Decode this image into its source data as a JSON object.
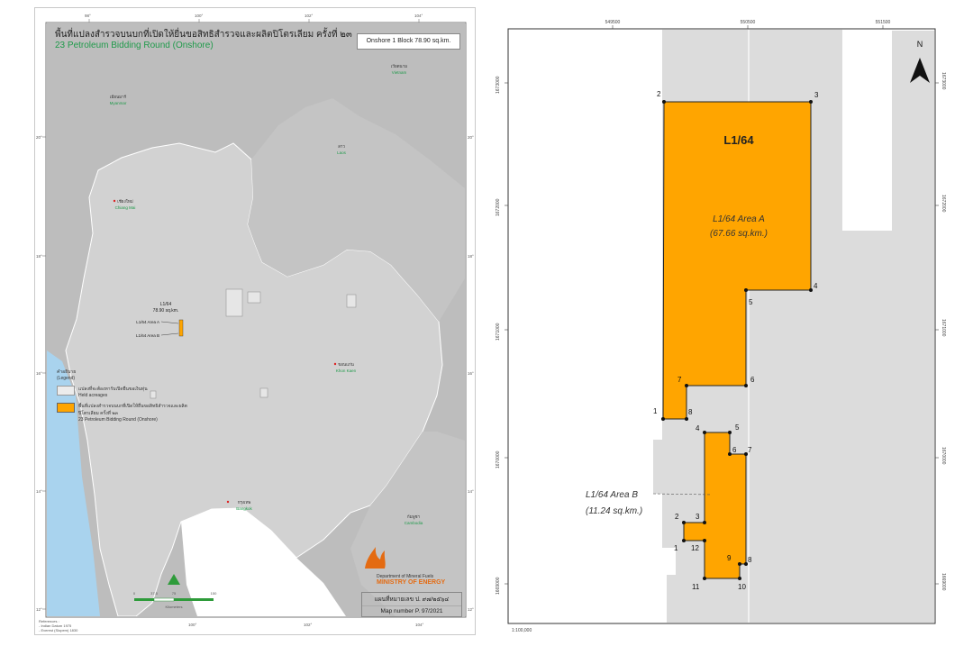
{
  "left_map": {
    "title_th": "พื้นที่แปลงสำรวจบนบกที่เปิดให้ยื่นขอสิทธิสำรวจและผลิตปิโตรเลียม ครั้งที่ ๒๓",
    "title_en": "23  Petroleum Bidding Round (Onshore)",
    "area_box": "Onshore 1 Block 78.90 sq.km.",
    "top_ticks": [
      "98°",
      "100°",
      "102°",
      "104°"
    ],
    "bottom_ticks": [
      "100°",
      "102°",
      "104°"
    ],
    "left_ticks": [
      "20°",
      "18°",
      "16°",
      "14°",
      "12°"
    ],
    "right_ticks": [
      "20°",
      "18°",
      "16°",
      "14°",
      "12°"
    ],
    "places": [
      {
        "th": "เมียนมาร์",
        "en": "Myanmar",
        "color": "#1f9a4a"
      },
      {
        "th": "เวียดนาม",
        "en": "Vietnam",
        "color": "#1f9a4a"
      },
      {
        "th": "ลาว",
        "en": "Laos",
        "color": "#1f9a4a"
      },
      {
        "th": "เชียงใหม่",
        "en": "Chiang Mai",
        "color": "#1f9a4a"
      },
      {
        "th": "ขอนแก่น",
        "en": "Khon Kaen",
        "color": "#1f9a4a"
      },
      {
        "th": "กรุงเทพ",
        "en": "Bangkok",
        "color": "#1f9a4a"
      },
      {
        "th": "กัมพูชา",
        "en": "Cambodia",
        "color": "#1f9a4a"
      }
    ],
    "block_callout": {
      "name": "L1/64",
      "area": "78.90 sq.km.",
      "area_a": "L1/64 Area A",
      "area_b": "L1/64 Area B"
    },
    "legend": {
      "title_th": "คำอธิบาย",
      "title_en": "(Legend)",
      "row1_th": "แปลงที่จะต้องหารับเปิดยืนขอเงินทุ่น",
      "row1_en": "Held acreages",
      "row2_th": "พื้นที่แปลงสำรวจบนบกที่เปิดให้ยื่นขอสิทธิสำรวจและผลิตปิโตรเลียม ครั้งที่ ๒๓",
      "row2_en": "23   Petroleum Bidding Round (Onshore)"
    },
    "scale_labels": [
      "0",
      "37.5",
      "75",
      "150"
    ],
    "scale_unit": "Kilometers",
    "doe_line1": "Department of Mineral Fuels",
    "doe_line2": "MINISTRY OF ENERGY",
    "mapnum_th": "แผนที่หมายเลข ป. ๙๗/๒๕๖๔",
    "mapnum_en": "Map number P. 97/2021",
    "refs": [
      "References :",
      "- Indian Datum 1975",
      "- Everest (Slopem) 1830"
    ]
  },
  "right_map": {
    "top_ticks": [
      "549500",
      "550500",
      "551500"
    ],
    "left_ticks": [
      "1673000",
      "1672000",
      "1671000",
      "1670000",
      "1669000"
    ],
    "right_ticks": [
      "1673000",
      "1672000",
      "1671000",
      "1670000",
      "1669000"
    ],
    "block_label": "L1/64",
    "area_a_label": "L1/64 Area A",
    "area_a_size": "(67.66 sq.km.)",
    "area_b_label": "L1/64 Area B",
    "area_b_size": "(11.24 sq.km.)",
    "north": "N",
    "scale": "1:100,000",
    "vertices_a": [
      "1",
      "2",
      "3",
      "4",
      "5",
      "6",
      "7",
      "8"
    ],
    "vertices_b": [
      "1",
      "2",
      "3",
      "4",
      "5",
      "6",
      "7",
      "8",
      "9",
      "10",
      "11",
      "12"
    ]
  },
  "colors": {
    "block_orange": "#ffa500",
    "held_gray": "#dcdcdc",
    "sea_blue": "#a9d3ee",
    "thai_fill": "#d2d2d2",
    "country_fill": "#bdbdbd",
    "green_text": "#1f9a4a"
  }
}
